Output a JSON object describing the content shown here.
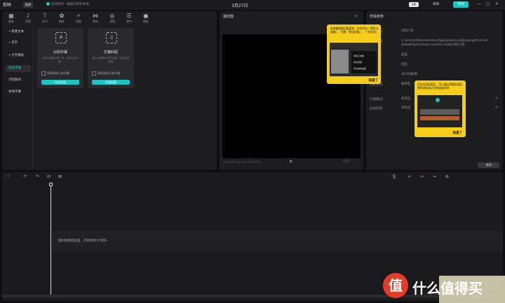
{
  "titlebar": {
    "logo": "剪映",
    "menu": "菜单",
    "save_status": "自动保存 · 数据已保存本地",
    "center_title": "3月27日",
    "vip": "VIP",
    "share": "审阅",
    "export": "导出",
    "win_min": "—",
    "win_max": "▢",
    "win_close": "✕"
  },
  "media_tabs": [
    {
      "label": "媒体",
      "icon": "▦"
    },
    {
      "label": "音频",
      "icon": "♪"
    },
    {
      "label": "文本",
      "icon": "T"
    },
    {
      "label": "贴纸",
      "icon": "✿"
    },
    {
      "label": "特效",
      "icon": "✧"
    },
    {
      "label": "转场",
      "icon": "⋈"
    },
    {
      "label": "滤镜",
      "icon": "◎"
    },
    {
      "label": "调节",
      "icon": "☰"
    },
    {
      "label": "模板",
      "icon": "▣"
    }
  ],
  "side_items": [
    "• 新建文本",
    "• 花字",
    "• 文字模板",
    "智能字幕",
    "识别歌词",
    "本地字幕"
  ],
  "cards": [
    {
      "title": "识别字幕",
      "desc": "识别音视频中的人声，自动生成字幕。",
      "check": "同时清空已有字幕",
      "button": "开始识别",
      "icon": "A"
    },
    {
      "title": "文稿匹配",
      "desc": "输入音视频对应的文稿，自动匹配画面",
      "check": "同时清空已有字幕",
      "button": "开始匹配",
      "icon": "♫"
    }
  ],
  "player": {
    "title": "播放器",
    "time": "00:00:00:00 / 00:00:00:00",
    "play": "▶",
    "ratio": "比例",
    "fullscreen": "⛶",
    "menu": "≡"
  },
  "tip1": {
    "text": "新增播放器功能菜单，支持开启「调色示波器」、切换「预览质量」、「导出帧」",
    "menu_items": [
      "调色示波器",
      "预览质量",
      "导出静帧画面"
    ],
    "ok": "知道了"
  },
  "params": {
    "title": "草稿参数",
    "rows": [
      {
        "label": "草稿名称:",
        "value": "3月27日"
      },
      {
        "label": "保存位置:",
        "value": "C:/Users/Administrator/AppData/Local/JianyingPro/User Data/Projects/com.lveditor.draft/3月27日"
      },
      {
        "label": "比例:",
        "value": "适应"
      },
      {
        "label": "分辨率:",
        "value": "适应"
      },
      {
        "label": "帧率:",
        "value": "30.00帧/秒"
      },
      {
        "label": "色彩空间:",
        "value": "保持在…"
      },
      {
        "label": "代理模式:",
        "value": "未开启"
      },
      {
        "label": "自由层级:",
        "value": "未开启"
      }
    ],
    "modify": "修改"
  },
  "tip2": {
    "text": "开启自由层级后，可以通过调整轨道位置修改轨道之间的层级关系",
    "ok": "知道了"
  },
  "timeline": {
    "drop_hint": "素材拖拽到这里，开始你的大作吧~",
    "tools": [
      "⬚",
      "↶",
      "↷",
      "⊟",
      "⊠"
    ],
    "right_tools": [
      "🎙",
      "⇔",
      "⇔",
      "⇔",
      "⊕"
    ]
  },
  "watermark": {
    "circle": "值",
    "word": "什么值得买"
  }
}
